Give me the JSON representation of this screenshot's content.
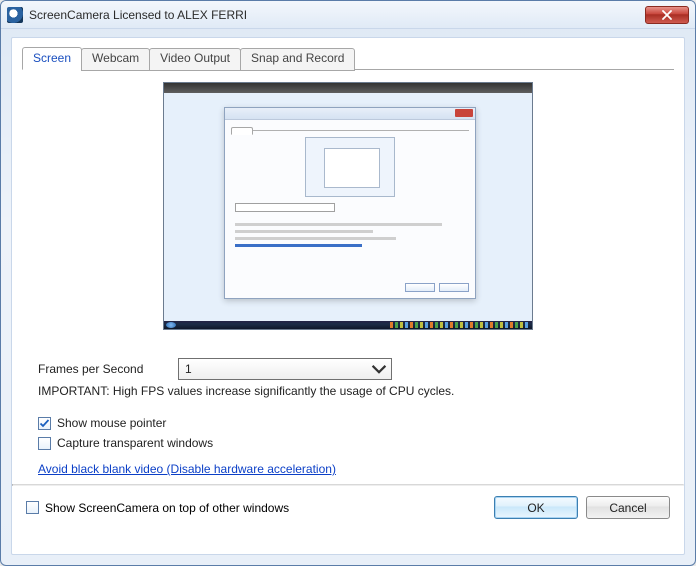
{
  "window": {
    "title": "ScreenCamera Licensed to ALEX FERRI"
  },
  "tabs": [
    {
      "label": "Screen",
      "active": true
    },
    {
      "label": "Webcam",
      "active": false
    },
    {
      "label": "Video Output",
      "active": false
    },
    {
      "label": "Snap and Record",
      "active": false
    }
  ],
  "screen_tab": {
    "fps_label": "Frames per Second",
    "fps_value": "1",
    "important_note": "IMPORTANT: High FPS values increase significantly the usage of CPU cycles.",
    "show_mouse_pointer": {
      "label": "Show mouse pointer",
      "checked": true
    },
    "capture_transparent": {
      "label": "Capture transparent windows",
      "checked": false
    },
    "hw_accel_link": "Avoid black blank video (Disable hardware acceleration)"
  },
  "footer": {
    "show_on_top": {
      "label": "Show ScreenCamera on top of other windows",
      "checked": false
    },
    "ok": "OK",
    "cancel": "Cancel"
  }
}
